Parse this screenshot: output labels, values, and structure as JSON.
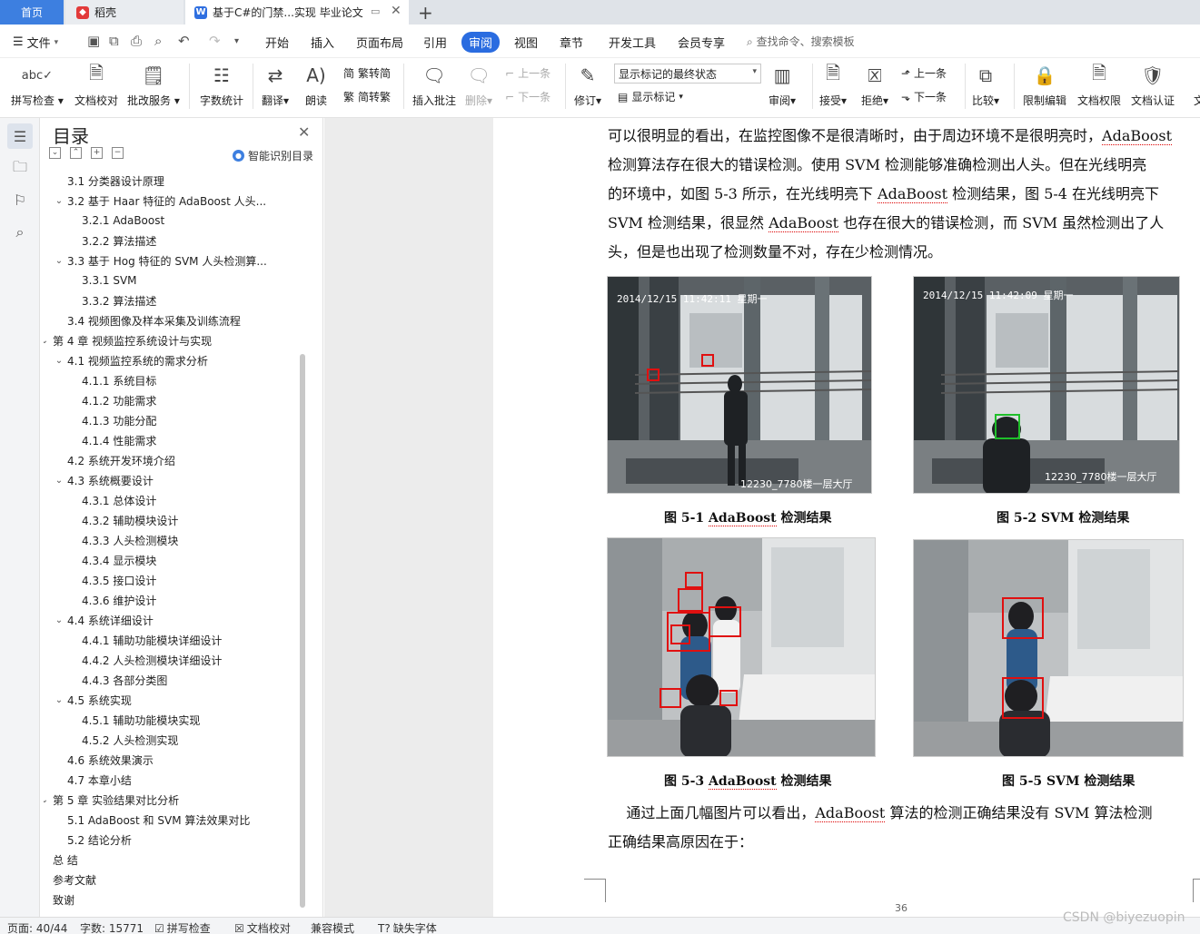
{
  "tabs": {
    "home": "首页",
    "daoke": "稻壳",
    "doc": "基于C#的门禁...实现 毕业论文"
  },
  "menu": {
    "file": "文件",
    "tabs": [
      "开始",
      "插入",
      "页面布局",
      "引用",
      "审阅",
      "视图",
      "章节",
      "开发工具",
      "会员专享"
    ],
    "active_tab": "审阅",
    "search": "查找命令、搜索模板"
  },
  "ribbon": {
    "spell_check": "拼写检查",
    "doc_proof": "文档校对",
    "annotate_service": "批改服务",
    "word_count": "字数统计",
    "translate": "翻译",
    "read_aloud": "朗读",
    "trad_to_simp": "繁转简",
    "simp_to_trad": "简转繁",
    "insert_comment": "插入批注",
    "delete": "删除",
    "prev_comment": "上一条",
    "next_comment": "下一条",
    "revise": "修订",
    "markup_state": "显示标记的最终状态",
    "show_markup": "显示标记",
    "review": "审阅",
    "accept": "接受",
    "reject": "拒绝",
    "prev_change": "上一条",
    "next_change": "下一条",
    "compare": "比较",
    "restrict_edit": "限制编辑",
    "doc_permission": "文档权限",
    "doc_auth": "文档认证",
    "more": "文"
  },
  "toc": {
    "title": "目录",
    "smart": "智能识别目录",
    "items": [
      {
        "label": "3.1  分类器设计原理",
        "level": 2,
        "chev": ""
      },
      {
        "label": "3.2  基于 Haar 特征的 AdaBoost 人头...",
        "level": 2,
        "chev": "v"
      },
      {
        "label": "3.2.1 AdaBoost",
        "level": 3,
        "chev": ""
      },
      {
        "label": "3.2.2  算法描述",
        "level": 3,
        "chev": ""
      },
      {
        "label": "3.3  基于 Hog 特征的 SVM 人头检测算...",
        "level": 2,
        "chev": "v"
      },
      {
        "label": "3.3.1 SVM",
        "level": 3,
        "chev": ""
      },
      {
        "label": "3.3.2  算法描述",
        "level": 3,
        "chev": ""
      },
      {
        "label": "3.4  视频图像及样本采集及训练流程",
        "level": 2,
        "chev": ""
      },
      {
        "label": "第 4 章    视频监控系统设计与实现",
        "level": 1,
        "chev": "v"
      },
      {
        "label": "4.1    视频监控系统的需求分析",
        "level": 2,
        "chev": "v"
      },
      {
        "label": "4.1.1    系统目标",
        "level": 3,
        "chev": ""
      },
      {
        "label": "4.1.2  功能需求",
        "level": 3,
        "chev": ""
      },
      {
        "label": "4.1.3  功能分配",
        "level": 3,
        "chev": ""
      },
      {
        "label": "4.1.4  性能需求",
        "level": 3,
        "chev": ""
      },
      {
        "label": "4.2  系统开发环境介绍",
        "level": 2,
        "chev": ""
      },
      {
        "label": "4.3 系统概要设计",
        "level": 2,
        "chev": "v"
      },
      {
        "label": "4.3.1  总体设计",
        "level": 3,
        "chev": ""
      },
      {
        "label": "4.3.2  辅助模块设计",
        "level": 3,
        "chev": ""
      },
      {
        "label": "4.3.3  人头检测模块",
        "level": 3,
        "chev": ""
      },
      {
        "label": "4.3.4  显示模块",
        "level": 3,
        "chev": ""
      },
      {
        "label": "4.3.5  接口设计",
        "level": 3,
        "chev": ""
      },
      {
        "label": "4.3.6 维护设计",
        "level": 3,
        "chev": ""
      },
      {
        "label": "4.4  系统详细设计",
        "level": 2,
        "chev": "v"
      },
      {
        "label": "4.4.1  辅助功能模块详细设计",
        "level": 3,
        "chev": ""
      },
      {
        "label": "4.4.2  人头检测模块详细设计",
        "level": 3,
        "chev": ""
      },
      {
        "label": "4.4.3  各部分类图",
        "level": 3,
        "chev": ""
      },
      {
        "label": "4.5  系统实现",
        "level": 2,
        "chev": "v"
      },
      {
        "label": "4.5.1  辅助功能模块实现",
        "level": 3,
        "chev": ""
      },
      {
        "label": "4.5.2 人头检测实现",
        "level": 3,
        "chev": ""
      },
      {
        "label": "4.6  系统效果演示",
        "level": 2,
        "chev": ""
      },
      {
        "label": "4.7 本章小结",
        "level": 2,
        "chev": ""
      },
      {
        "label": "第 5 章    实验结果对比分析",
        "level": 1,
        "chev": "v"
      },
      {
        "label": "5.1 AdaBoost 和 SVM 算法效果对比",
        "level": 2,
        "chev": ""
      },
      {
        "label": "5.2 结论分析",
        "level": 2,
        "chev": ""
      },
      {
        "label": "总  结",
        "level": 1,
        "chev": ""
      },
      {
        "label": "参考文献",
        "level": 1,
        "chev": ""
      },
      {
        "label": "致谢",
        "level": 1,
        "chev": ""
      }
    ]
  },
  "document": {
    "para1_lines": [
      [
        "可以很明显的看出，在监控图像不是很清晰时，由于周边环境不是很明亮时，",
        "AdaBoost",
        ""
      ],
      [
        "检测算法存在很大的错误检测。使用 SVM 检测能够准确检测出人头。但在光线明亮",
        "",
        ""
      ],
      [
        "的环境中，如图 5-3 所示，在光线明亮下 ",
        "AdaBoost",
        " 检测结果，图 5-4 在光线明亮下"
      ],
      [
        "SVM 检测结果，很显然 ",
        "AdaBoost",
        " 也存在很大的错误检测，而 SVM 虽然检测出了人"
      ],
      [
        "头，但是也出现了检测数量不对，存在少检测情况。",
        "",
        ""
      ]
    ],
    "fig1_stamp": "2014/12/15 11:42:11    星期一",
    "fig1_cam": "12230_7780楼一层大厅",
    "fig2_stamp": "2014/12/15 11:42:09    星期一",
    "fig2_cam": "12230_7780楼一层大厅",
    "cap1": [
      "图 5-1 ",
      "AdaBoost",
      " 检测结果"
    ],
    "cap2": "图 5-2    SVM 检测结果",
    "cap3": [
      "图 5-3 ",
      "AdaBoost",
      " 检测结果"
    ],
    "cap4": "图 5-5    SVM 检测结果",
    "para2_lines": [
      [
        "    通过上面几幅图片可以看出，",
        "AdaBoost",
        " 算法的检测正确结果没有 SVM 算法检测"
      ],
      [
        "正确结果高原因在于：",
        "",
        ""
      ]
    ],
    "page_number": "36"
  },
  "status": {
    "page": "页面: 40/44",
    "words": "字数: 15771",
    "spell": "拼写检查",
    "proof": "文档校对",
    "compat": "兼容模式",
    "missing_font": "缺失字体"
  },
  "watermark": "CSDN @biyezuopin",
  "colors": {
    "accent": "#2a6ce0",
    "detect_red": "#e01010",
    "detect_green": "#1fbf2a"
  }
}
